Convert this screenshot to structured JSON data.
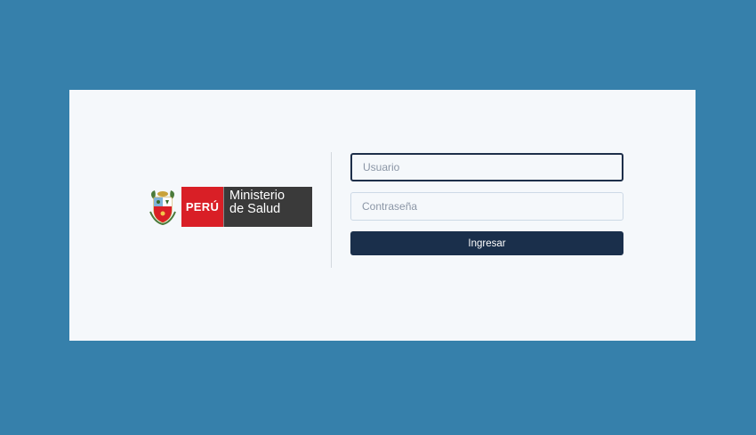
{
  "logo": {
    "country": "PERÚ",
    "ministry_line1": "Ministerio",
    "ministry_line2": "de Salud"
  },
  "login": {
    "username_placeholder": "Usuario",
    "password_placeholder": "Contraseña",
    "submit_label": "Ingresar"
  },
  "colors": {
    "background": "#3680ab",
    "card": "#f5f8fb",
    "button": "#1a2f4b",
    "peru_red": "#d91f26"
  }
}
